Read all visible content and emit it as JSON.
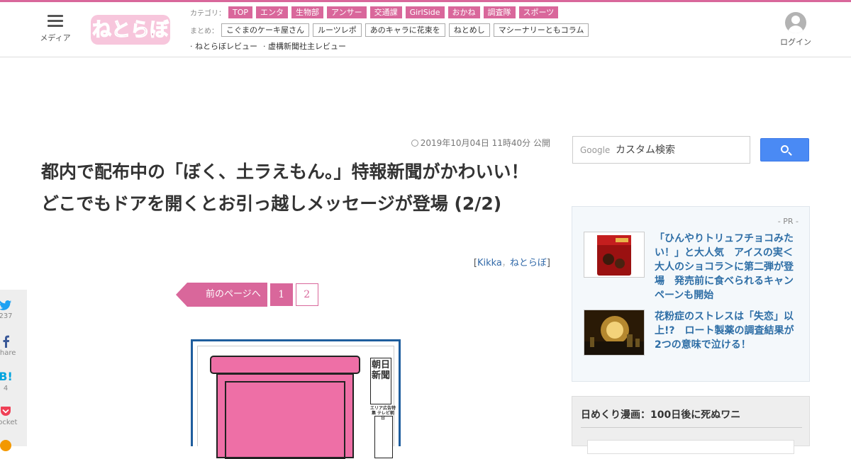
{
  "header": {
    "menu_label": "メディア",
    "logo_alt": "ねとらぼ",
    "category_label": "カテゴリ：",
    "categories": [
      "TOP",
      "エンタ",
      "生物部",
      "アンサー",
      "交通課",
      "GirlSide",
      "おかね",
      "調査隊",
      "スポーツ"
    ],
    "summary_label": "まとめ：",
    "summaries": [
      "こぐまのケーキ屋さん",
      "ルーツレポ",
      "あのキャラに花束を",
      "ねとめし",
      "マシーナリーともコラム"
    ],
    "reviews": [
      "· ねとらぼレビュー",
      "· 虚構新聞社主レビュー"
    ],
    "login_label": "ログイン"
  },
  "article": {
    "date": "2019年10月04日 11時40分 公開",
    "title": "都内で配布中の「ぼく、土ラえもん。」特報新聞がかわいい！　どこでもドアを開くとお引っ越しメッセージが登場 (2/2)",
    "byline_open": "[",
    "author": "Kikka",
    "byline_sep": "，",
    "publisher": "ねとらぼ",
    "byline_close": "]"
  },
  "pager": {
    "prev_label": "前のページへ",
    "pages": [
      "1",
      "2"
    ],
    "current": "1"
  },
  "figure": {
    "paper_name": "朝日新聞",
    "paper_sub": "エリア広告特集 テレビ朝日"
  },
  "share": [
    {
      "icon": "twitter-icon",
      "count": "237"
    },
    {
      "icon": "facebook-icon",
      "count": "Share"
    },
    {
      "icon": "hatena-icon",
      "count": "4"
    },
    {
      "icon": "pocket-icon",
      "count": "Pocket"
    }
  ],
  "sidebar": {
    "search_brand": "Google",
    "search_placeholder": "カスタム検索",
    "pr_label": "- PR -",
    "pr_items": [
      {
        "text": "「ひんやりトリュフチョコみたい！」と大人気　アイスの実＜大人のショコラ＞に第二弾が登場　発売前に食べられるキャンペーンも開始"
      },
      {
        "text": "花粉症のストレスは「失恋」以上!?　ロート製薬の調査結果が2つの意味で泣ける！"
      }
    ],
    "manga_title": "日めくり漫画：100日後に死ぬワニ"
  },
  "colors": {
    "brand_pink": "#d9679b",
    "link_blue": "#2e6ea6",
    "search_blue": "#4a8af4"
  }
}
